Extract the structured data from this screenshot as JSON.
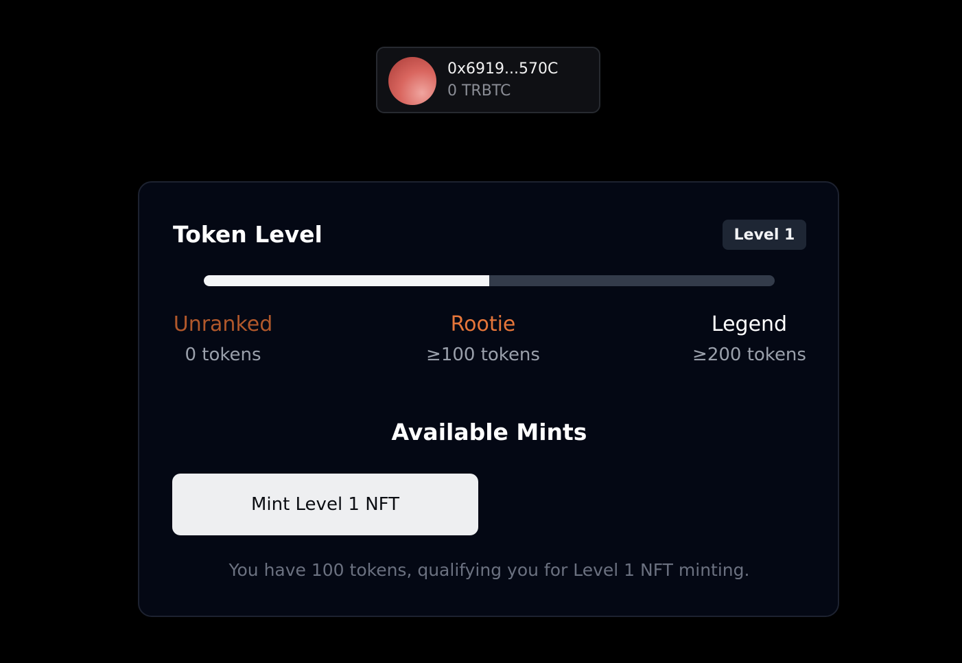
{
  "wallet": {
    "address": "0x6919...570C",
    "balance": "0 TRBTC"
  },
  "token_level": {
    "title": "Token Level",
    "badge": "Level 1",
    "progress_fraction": 0.5,
    "tiers": [
      {
        "name": "Unranked",
        "requirement": "0 tokens",
        "color": "#b1582b"
      },
      {
        "name": "Rootie",
        "requirement": "≥100 tokens",
        "color": "#e6763a"
      },
      {
        "name": "Legend",
        "requirement": "≥200 tokens",
        "color": "#ffffff"
      }
    ]
  },
  "mints": {
    "title": "Available Mints",
    "button_label": "Mint Level 1 NFT",
    "note": "You have 100 tokens, qualifying you for Level 1 NFT minting."
  }
}
